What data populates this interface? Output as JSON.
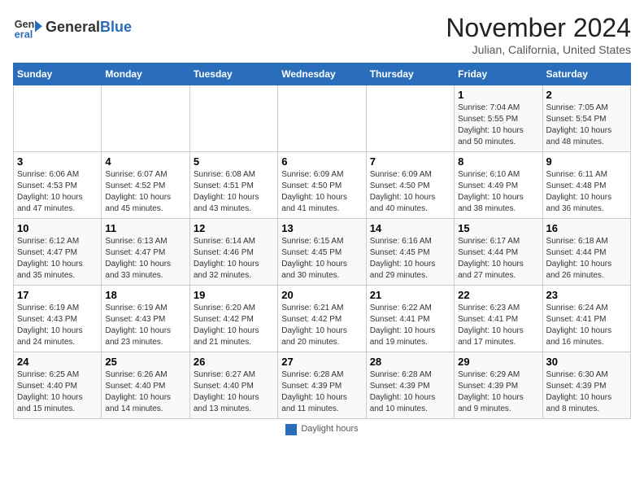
{
  "header": {
    "logo_line1": "General",
    "logo_line2": "Blue",
    "month_title": "November 2024",
    "location": "Julian, California, United States"
  },
  "days_of_week": [
    "Sunday",
    "Monday",
    "Tuesday",
    "Wednesday",
    "Thursday",
    "Friday",
    "Saturday"
  ],
  "weeks": [
    [
      {
        "day": "",
        "info": ""
      },
      {
        "day": "",
        "info": ""
      },
      {
        "day": "",
        "info": ""
      },
      {
        "day": "",
        "info": ""
      },
      {
        "day": "",
        "info": ""
      },
      {
        "day": "1",
        "info": "Sunrise: 7:04 AM\nSunset: 5:55 PM\nDaylight: 10 hours\nand 50 minutes."
      },
      {
        "day": "2",
        "info": "Sunrise: 7:05 AM\nSunset: 5:54 PM\nDaylight: 10 hours\nand 48 minutes."
      }
    ],
    [
      {
        "day": "3",
        "info": "Sunrise: 6:06 AM\nSunset: 4:53 PM\nDaylight: 10 hours\nand 47 minutes."
      },
      {
        "day": "4",
        "info": "Sunrise: 6:07 AM\nSunset: 4:52 PM\nDaylight: 10 hours\nand 45 minutes."
      },
      {
        "day": "5",
        "info": "Sunrise: 6:08 AM\nSunset: 4:51 PM\nDaylight: 10 hours\nand 43 minutes."
      },
      {
        "day": "6",
        "info": "Sunrise: 6:09 AM\nSunset: 4:50 PM\nDaylight: 10 hours\nand 41 minutes."
      },
      {
        "day": "7",
        "info": "Sunrise: 6:09 AM\nSunset: 4:50 PM\nDaylight: 10 hours\nand 40 minutes."
      },
      {
        "day": "8",
        "info": "Sunrise: 6:10 AM\nSunset: 4:49 PM\nDaylight: 10 hours\nand 38 minutes."
      },
      {
        "day": "9",
        "info": "Sunrise: 6:11 AM\nSunset: 4:48 PM\nDaylight: 10 hours\nand 36 minutes."
      }
    ],
    [
      {
        "day": "10",
        "info": "Sunrise: 6:12 AM\nSunset: 4:47 PM\nDaylight: 10 hours\nand 35 minutes."
      },
      {
        "day": "11",
        "info": "Sunrise: 6:13 AM\nSunset: 4:47 PM\nDaylight: 10 hours\nand 33 minutes."
      },
      {
        "day": "12",
        "info": "Sunrise: 6:14 AM\nSunset: 4:46 PM\nDaylight: 10 hours\nand 32 minutes."
      },
      {
        "day": "13",
        "info": "Sunrise: 6:15 AM\nSunset: 4:45 PM\nDaylight: 10 hours\nand 30 minutes."
      },
      {
        "day": "14",
        "info": "Sunrise: 6:16 AM\nSunset: 4:45 PM\nDaylight: 10 hours\nand 29 minutes."
      },
      {
        "day": "15",
        "info": "Sunrise: 6:17 AM\nSunset: 4:44 PM\nDaylight: 10 hours\nand 27 minutes."
      },
      {
        "day": "16",
        "info": "Sunrise: 6:18 AM\nSunset: 4:44 PM\nDaylight: 10 hours\nand 26 minutes."
      }
    ],
    [
      {
        "day": "17",
        "info": "Sunrise: 6:19 AM\nSunset: 4:43 PM\nDaylight: 10 hours\nand 24 minutes."
      },
      {
        "day": "18",
        "info": "Sunrise: 6:19 AM\nSunset: 4:43 PM\nDaylight: 10 hours\nand 23 minutes."
      },
      {
        "day": "19",
        "info": "Sunrise: 6:20 AM\nSunset: 4:42 PM\nDaylight: 10 hours\nand 21 minutes."
      },
      {
        "day": "20",
        "info": "Sunrise: 6:21 AM\nSunset: 4:42 PM\nDaylight: 10 hours\nand 20 minutes."
      },
      {
        "day": "21",
        "info": "Sunrise: 6:22 AM\nSunset: 4:41 PM\nDaylight: 10 hours\nand 19 minutes."
      },
      {
        "day": "22",
        "info": "Sunrise: 6:23 AM\nSunset: 4:41 PM\nDaylight: 10 hours\nand 17 minutes."
      },
      {
        "day": "23",
        "info": "Sunrise: 6:24 AM\nSunset: 4:41 PM\nDaylight: 10 hours\nand 16 minutes."
      }
    ],
    [
      {
        "day": "24",
        "info": "Sunrise: 6:25 AM\nSunset: 4:40 PM\nDaylight: 10 hours\nand 15 minutes."
      },
      {
        "day": "25",
        "info": "Sunrise: 6:26 AM\nSunset: 4:40 PM\nDaylight: 10 hours\nand 14 minutes."
      },
      {
        "day": "26",
        "info": "Sunrise: 6:27 AM\nSunset: 4:40 PM\nDaylight: 10 hours\nand 13 minutes."
      },
      {
        "day": "27",
        "info": "Sunrise: 6:28 AM\nSunset: 4:39 PM\nDaylight: 10 hours\nand 11 minutes."
      },
      {
        "day": "28",
        "info": "Sunrise: 6:28 AM\nSunset: 4:39 PM\nDaylight: 10 hours\nand 10 minutes."
      },
      {
        "day": "29",
        "info": "Sunrise: 6:29 AM\nSunset: 4:39 PM\nDaylight: 10 hours\nand 9 minutes."
      },
      {
        "day": "30",
        "info": "Sunrise: 6:30 AM\nSunset: 4:39 PM\nDaylight: 10 hours\nand 8 minutes."
      }
    ]
  ],
  "legend": {
    "box_label": "Daylight hours"
  }
}
